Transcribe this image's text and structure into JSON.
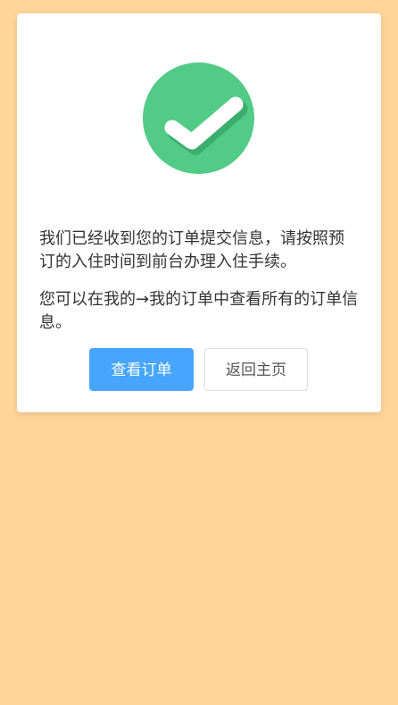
{
  "card": {
    "message_1": "我们已经收到您的订单提交信息，请按照预订的入住时间到前台办理入住手续。",
    "message_2": "您可以在我的→我的订单中查看所有的订单信息。"
  },
  "actions": {
    "view_orders_label": "查看订单",
    "back_home_label": "返回主页"
  },
  "icons": {
    "success": "checkmark-circle-icon"
  },
  "colors": {
    "page_background": "#FFD599",
    "success_green": "#52CB86",
    "primary_button": "#46A6FF"
  }
}
